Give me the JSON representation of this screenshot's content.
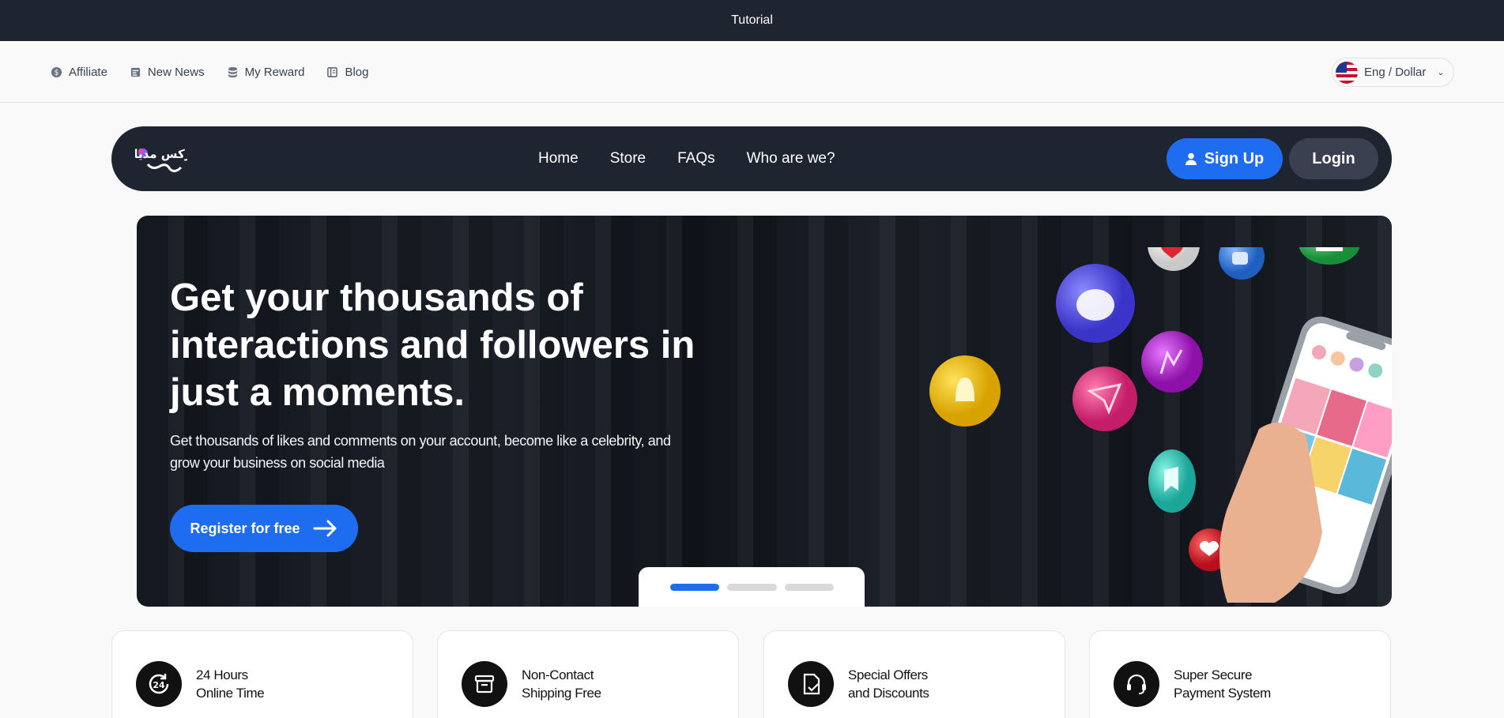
{
  "topbar": {
    "title": "Tutorial"
  },
  "subnav": {
    "links": [
      {
        "label": "Affiliate",
        "icon": "dollar-coin-icon"
      },
      {
        "label": "New News",
        "icon": "newspaper-icon"
      },
      {
        "label": "My Reward",
        "icon": "database-icon"
      },
      {
        "label": "Blog",
        "icon": "book-icon"
      }
    ],
    "language": {
      "label": "Eng / Dollar",
      "icon": "us-flag-icon"
    }
  },
  "mainnav": {
    "logo_text": "ترکس مدیا",
    "links": [
      "Home",
      "Store",
      "FAQs",
      "Who are we?"
    ],
    "signup": "Sign Up",
    "login": "Login"
  },
  "hero": {
    "title": "Get your thousands of interactions and followers in just a moments.",
    "subtitle": "Get thousands of likes and comments on your account, become like a celebrity, and grow your business on social media",
    "cta": "Register for free",
    "slides_total": 3,
    "active_slide": 1
  },
  "features": [
    {
      "line1": "24 Hours",
      "line2": "Online Time",
      "icon": "24-hours-icon"
    },
    {
      "line1": "Non-Contact",
      "line2": "Shipping Free",
      "icon": "box-icon"
    },
    {
      "line1": "Special Offers",
      "line2": "and Discounts",
      "icon": "discount-document-icon"
    },
    {
      "line1": "Super Secure",
      "line2": "Payment System",
      "icon": "headset-icon"
    }
  ],
  "colors": {
    "primary": "#1e6df0",
    "dark": "#1e2430"
  }
}
